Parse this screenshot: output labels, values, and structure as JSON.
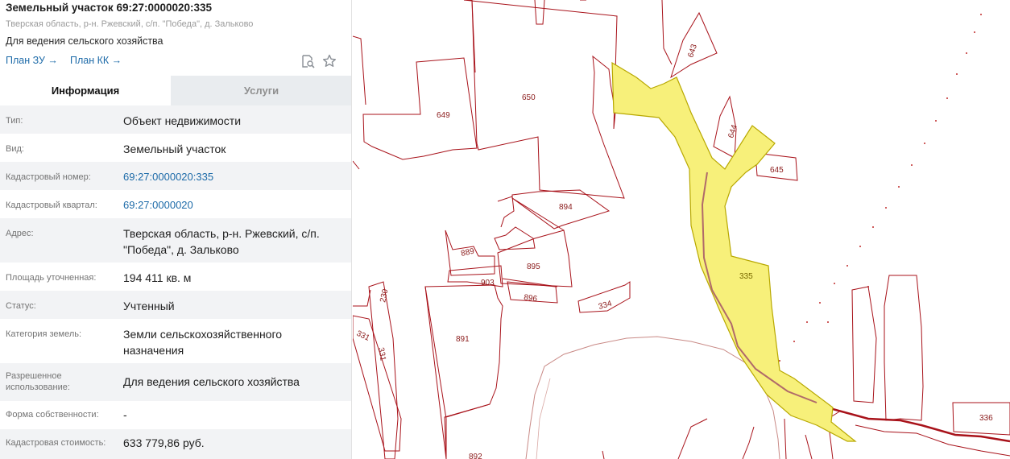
{
  "header": {
    "title": "Земельный участок 69:27:0000020:335",
    "subtitle": "Тверская область, р-н. Ржевский, с/п. \"Победа\", д. Зальково",
    "usage": "Для ведения сельского хозяйства",
    "plan_zu": "План ЗУ →",
    "plan_kk": "План КК →"
  },
  "tabs": {
    "info": "Информация",
    "services": "Услуги"
  },
  "fields": [
    {
      "label": "Тип:",
      "value": "Объект недвижимости"
    },
    {
      "label": "Вид:",
      "value": "Земельный участок"
    },
    {
      "label": "Кадастровый номер:",
      "value": "69:27:0000020:335"
    },
    {
      "label": "Кадастровый квартал:",
      "value": "69:27:0000020"
    },
    {
      "label": "Адрес:",
      "value": "Тверская область, р-н. Ржевский, с/п. \"Победа\", д. Зальково"
    },
    {
      "label": "Площадь уточненная:",
      "value": "194 411 кв. м"
    },
    {
      "label": "Статус:",
      "value": "Учтенный"
    },
    {
      "label": "Категория земель:",
      "value": "Земли сельскохозяйственного назначения"
    },
    {
      "label": "Разрешенное использование:",
      "value": "Для ведения сельского хозяйства"
    },
    {
      "label": "Форма собственности:",
      "value": "-"
    },
    {
      "label": "Кадастровая стоимость:",
      "value": "633 779,86 руб."
    }
  ],
  "icons": {
    "search_doc": "search-document-icon",
    "favorite": "star-icon"
  },
  "colors": {
    "link": "#1c6aa8",
    "parcel_border": "#a8121a",
    "selected_fill": "#f7f07a",
    "selected_border": "#b8a800"
  },
  "map": {
    "labels": {
      "p643": "643",
      "p650": "650",
      "p649": "649",
      "p644": "644",
      "p645": "645",
      "p894": "894",
      "p889": "889",
      "p895": "895",
      "p903": "903",
      "p896": "896",
      "p334": "334",
      "p335": "335",
      "p230": "230",
      "p331a": "331",
      "p331b": "331",
      "p891": "891",
      "p892": "892",
      "p336": "336"
    }
  }
}
